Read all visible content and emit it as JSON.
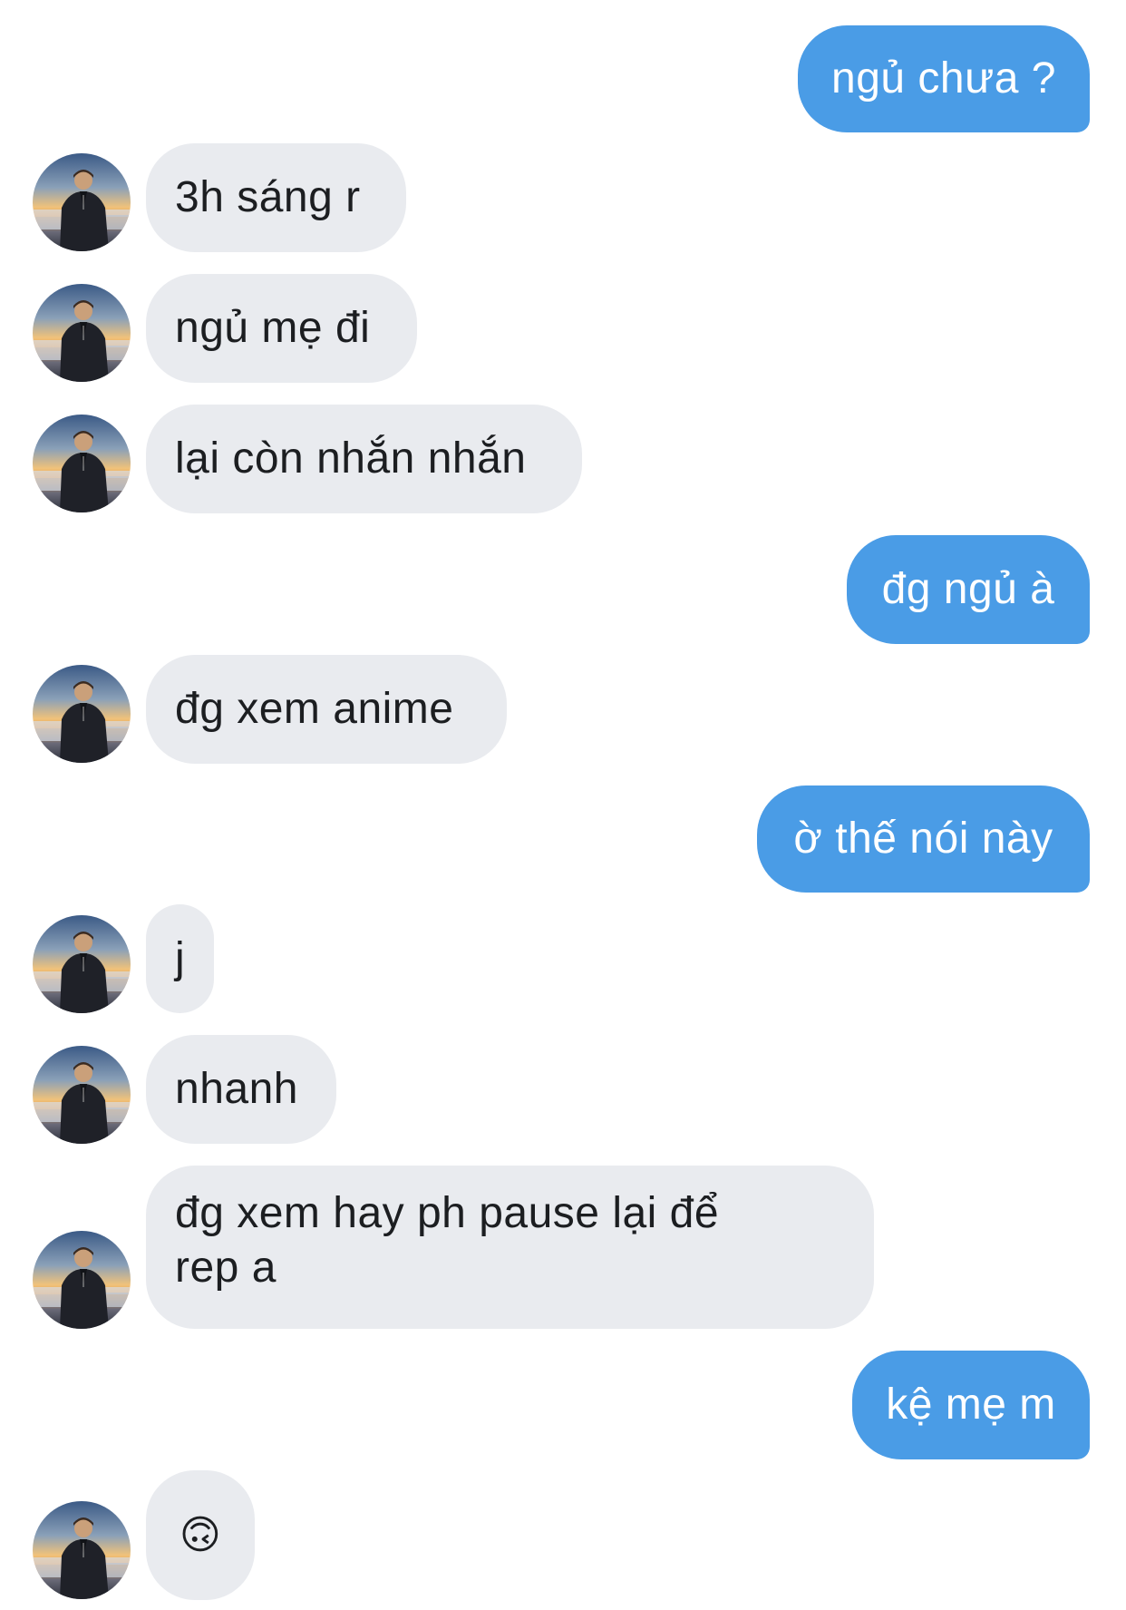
{
  "conversation": {
    "messages": [
      {
        "from": "me",
        "text": "ngủ chưa ?"
      },
      {
        "from": "them",
        "text": "3h sáng r"
      },
      {
        "from": "them",
        "text": "ngủ mẹ đi"
      },
      {
        "from": "them",
        "text": "lại còn nhắn nhắn"
      },
      {
        "from": "me",
        "text": "đg ngủ à"
      },
      {
        "from": "them",
        "text": "đg xem anime"
      },
      {
        "from": "me",
        "text": "ờ thế nói này"
      },
      {
        "from": "them",
        "text": "j"
      },
      {
        "from": "them",
        "text": "nhanh"
      },
      {
        "from": "them",
        "text_line1": "đg xem hay ph pause lại để",
        "text_line2": "rep a"
      },
      {
        "from": "me",
        "text": "kệ mẹ m"
      },
      {
        "from": "them",
        "emoji": "upside-down-face",
        "text": "🙃"
      }
    ]
  },
  "colors": {
    "sent_bubble": "#4a9ce6",
    "received_bubble": "#e9ebef",
    "sent_text": "#ffffff",
    "received_text": "#1c1e21"
  },
  "avatar": {
    "icon": "contact-profile-photo"
  }
}
